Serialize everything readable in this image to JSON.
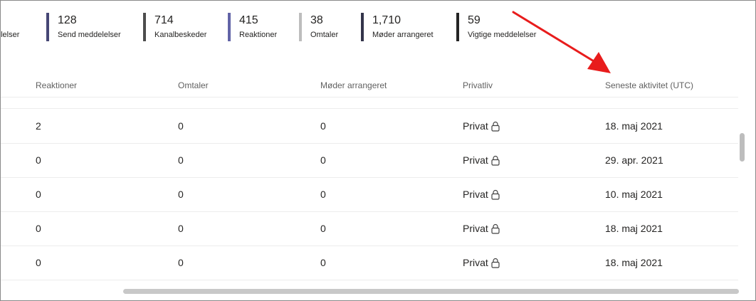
{
  "stats": [
    {
      "value": "",
      "label": "elelser"
    },
    {
      "value": "128",
      "label": "Send meddelelser",
      "color": "#464775"
    },
    {
      "value": "714",
      "label": "Kanalbeskeder",
      "color": "#4d4d4d"
    },
    {
      "value": "415",
      "label": "Reaktioner",
      "color": "#6264a7"
    },
    {
      "value": "38",
      "label": "Omtaler",
      "color": "#bdbdbd"
    },
    {
      "value": "1,710",
      "label": "Møder arrangeret",
      "color": "#33344a"
    },
    {
      "value": "59",
      "label": "Vigtige meddelelser",
      "color": "#242424"
    }
  ],
  "table": {
    "headers": [
      "Reaktioner",
      "Omtaler",
      "Møder arrangeret",
      "Privatliv",
      "Seneste aktivitet (UTC)"
    ],
    "rows": [
      {
        "reaktioner": "2",
        "omtaler": "0",
        "moder": "0",
        "privatliv": "Privat",
        "seneste": "18. maj 2021"
      },
      {
        "reaktioner": "0",
        "omtaler": "0",
        "moder": "0",
        "privatliv": "Privat",
        "seneste": "29. apr. 2021"
      },
      {
        "reaktioner": "0",
        "omtaler": "0",
        "moder": "0",
        "privatliv": "Privat",
        "seneste": "10. maj 2021"
      },
      {
        "reaktioner": "0",
        "omtaler": "0",
        "moder": "0",
        "privatliv": "Privat",
        "seneste": "18. maj 2021"
      },
      {
        "reaktioner": "0",
        "omtaler": "0",
        "moder": "0",
        "privatliv": "Privat",
        "seneste": "18. maj 2021"
      }
    ]
  },
  "icons": {
    "privacy": "lock-icon",
    "annotation": "red-arrow-icon"
  },
  "accent": {
    "arrow": "#e81c1c"
  }
}
